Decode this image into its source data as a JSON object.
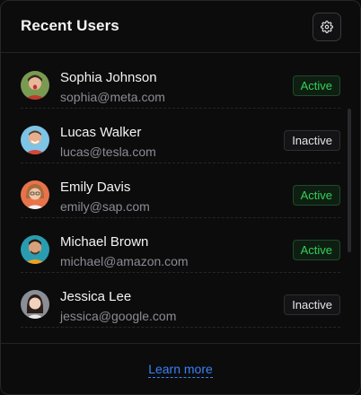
{
  "header": {
    "title": "Recent Users",
    "settings_icon": "gear-icon"
  },
  "users": [
    {
      "name": "Sophia Johnson",
      "email": "sophia@meta.com",
      "status": "Active"
    },
    {
      "name": "Lucas Walker",
      "email": "lucas@tesla.com",
      "status": "Inactive"
    },
    {
      "name": "Emily Davis",
      "email": "emily@sap.com",
      "status": "Active"
    },
    {
      "name": "Michael Brown",
      "email": "michael@amazon.com",
      "status": "Active"
    },
    {
      "name": "Jessica Lee",
      "email": "jessica@google.com",
      "status": "Inactive"
    }
  ],
  "footer": {
    "link_label": "Learn more"
  },
  "colors": {
    "active_text": "#34d058",
    "link": "#3b82f6",
    "background": "#0c0c0d"
  }
}
